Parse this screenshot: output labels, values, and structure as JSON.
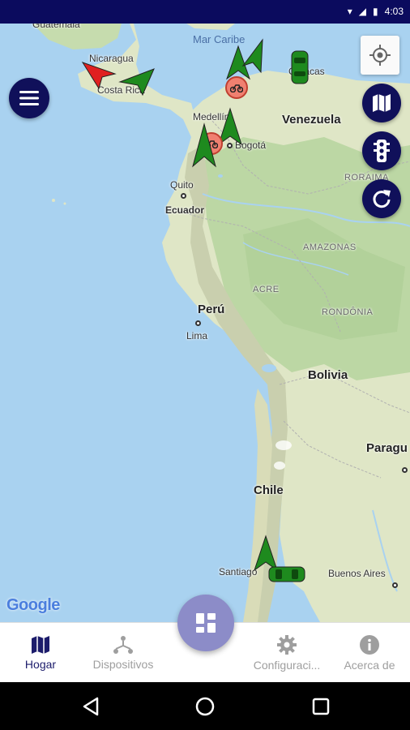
{
  "status_bar": {
    "time": "4:03",
    "bg_color": "#0b0b5e",
    "icons": [
      "wifi-icon",
      "signal-icon",
      "battery-icon"
    ]
  },
  "map": {
    "labels": {
      "guatemala": "Guatemala",
      "nicaragua": "Nicaragua",
      "costa_rica": "Costa Rica",
      "mar_caribe": "Mar Caribe",
      "caracas": "Caracas",
      "medellin": "Medellín",
      "venezuela": "Venezuela",
      "bogota": "Bogotá",
      "quito": "Quito",
      "ecuador": "Ecuador",
      "roraima": "RORAIMA",
      "amazonas": "AMAZONAS",
      "acre": "ACRE",
      "rondonia": "RONDÔNIA",
      "peru": "Perú",
      "lima": "Lima",
      "bolivia": "Bolivia",
      "paragu": "Paragu",
      "chile": "Chile",
      "santiago": "Santiago",
      "buenos_aires": "Buenos Aires"
    },
    "attribution": "Google",
    "colors": {
      "water": "#a9d2f0",
      "land": "#dfe6c6",
      "forest": "#bcd7a4",
      "marker_green": "#1e8a1e",
      "marker_red": "#e02020",
      "moto_badge": "#f08070"
    }
  },
  "controls": {
    "menu_icon": "menu-icon",
    "locate_icon": "locate-icon",
    "map_type_icon": "map-icon",
    "traffic_icon": "traffic-light-icon",
    "refresh_icon": "refresh-icon"
  },
  "bottom_nav": {
    "items": [
      {
        "label": "Hogar",
        "icon": "map-icon",
        "active": true
      },
      {
        "label": "Dispositivos",
        "icon": "devices-icon",
        "active": false
      },
      {
        "label": "Configuraci...",
        "icon": "gear-icon",
        "active": false
      },
      {
        "label": "Acerca de",
        "icon": "info-icon",
        "active": false
      }
    ],
    "center_icon": "dashboard-icon",
    "active_color": "#1c1c6b",
    "inactive_color": "#9e9e9e"
  },
  "android_nav": {
    "icons": [
      "back-icon",
      "home-icon",
      "recents-icon"
    ]
  }
}
